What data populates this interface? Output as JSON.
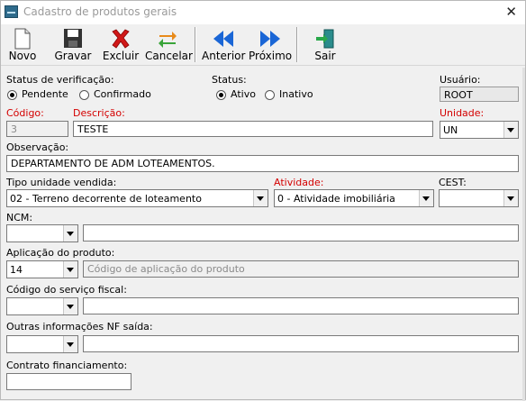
{
  "window": {
    "title": "Cadastro de produtos gerais",
    "close": "✕"
  },
  "toolbar": {
    "novo": "Novo",
    "gravar": "Gravar",
    "excluir": "Excluir",
    "cancelar": "Cancelar",
    "anterior": "Anterior",
    "proximo": "Próximo",
    "sair": "Sair"
  },
  "form": {
    "status_verificacao": {
      "label": "Status de verificação:",
      "opt1": "Pendente",
      "opt2": "Confirmado",
      "selected": "Pendente"
    },
    "status": {
      "label": "Status:",
      "opt1": "Ativo",
      "opt2": "Inativo",
      "selected": "Ativo"
    },
    "usuario": {
      "label": "Usuário:",
      "value": "ROOT"
    },
    "codigo": {
      "label": "Código:",
      "value": "3"
    },
    "descricao": {
      "label": "Descrição:",
      "value": "TESTE"
    },
    "unidade": {
      "label": "Unidade:",
      "value": "UN"
    },
    "observacao": {
      "label": "Observação:",
      "value": "DEPARTAMENTO DE ADM LOTEAMENTOS."
    },
    "tipo_unidade": {
      "label": "Tipo unidade vendida:",
      "value": "02 - Terreno decorrente de loteamento"
    },
    "atividade": {
      "label": "Atividade:",
      "value": "0 - Atividade imobiliária"
    },
    "cest": {
      "label": "CEST:",
      "value": ""
    },
    "ncm": {
      "label": "NCM:",
      "value": "",
      "desc": ""
    },
    "aplicacao": {
      "label": "Aplicação do produto:",
      "value": "14",
      "placeholder": "Código de aplicação do produto"
    },
    "servico_fiscal": {
      "label": "Código do serviço fiscal:",
      "value": "",
      "desc": ""
    },
    "outras_info": {
      "label": "Outras informações NF saída:",
      "value": "",
      "desc": ""
    },
    "contrato": {
      "label": "Contrato financiamento:",
      "value": ""
    }
  },
  "colors": {
    "required_label": "#d40000",
    "delete_red": "#d01818",
    "nav_blue": "#1a66d6"
  }
}
